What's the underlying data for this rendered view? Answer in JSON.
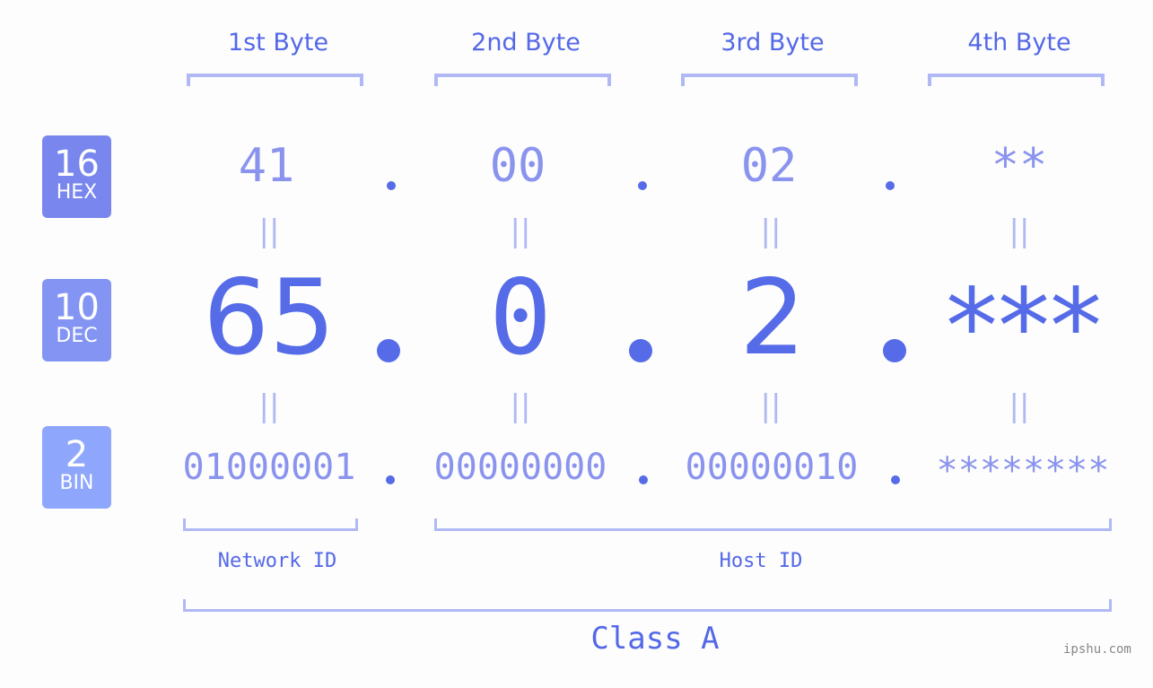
{
  "byte_headers": [
    "1st Byte",
    "2nd Byte",
    "3rd Byte",
    "4th Byte"
  ],
  "rows": {
    "hex": {
      "base": "16",
      "label": "HEX",
      "values": [
        "41",
        "00",
        "02",
        "**"
      ],
      "color": "#7886ed"
    },
    "dec": {
      "base": "10",
      "label": "DEC",
      "values": [
        "65",
        "0",
        "2",
        "***"
      ],
      "color": "#8494f3"
    },
    "bin": {
      "base": "2",
      "label": "BIN",
      "values": [
        "01000001",
        "00000000",
        "00000010",
        "********"
      ],
      "color": "#8ea6fb"
    }
  },
  "equals_symbol": "||",
  "segments": {
    "network": "Network ID",
    "host": "Host ID"
  },
  "class_label": "Class A",
  "watermark": "ipshu.com",
  "colors": {
    "accent": "#5468e8",
    "bracket": "#b0b9f5",
    "light_value": "#8a93ee"
  }
}
